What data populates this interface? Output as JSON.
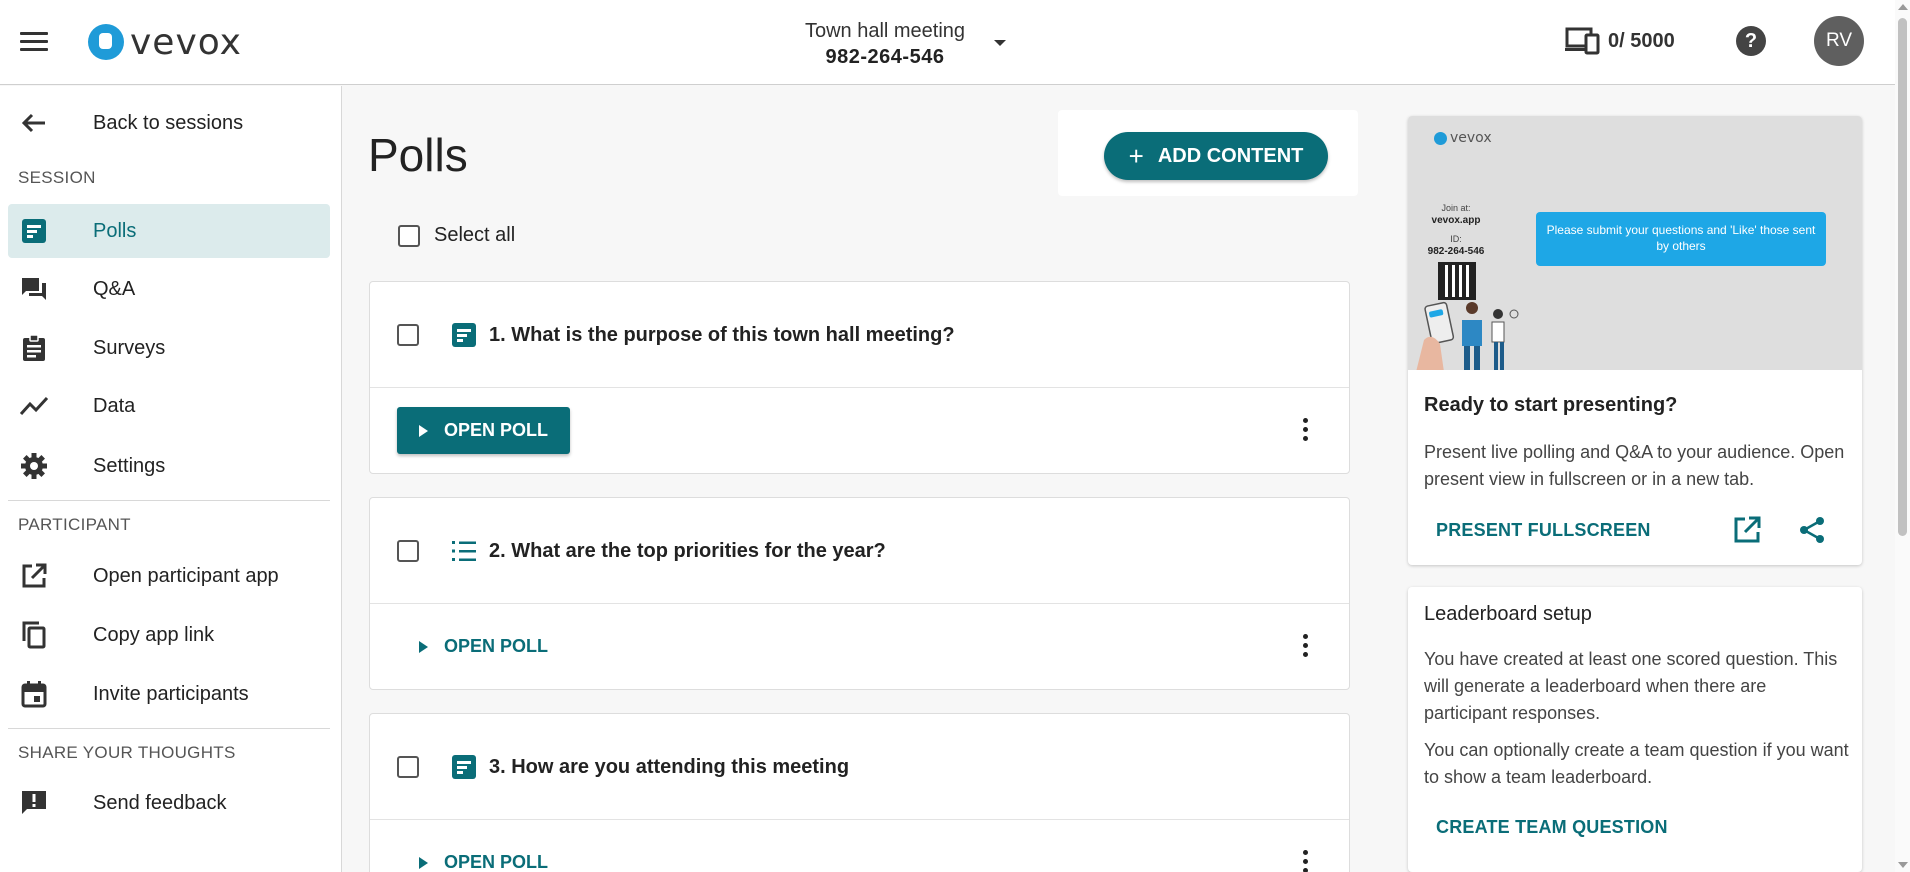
{
  "header": {
    "logo_text": "vevox",
    "session_name": "Town hall meeting",
    "session_id": "982-264-546",
    "participant_count": "0/ 5000",
    "help_label": "?",
    "avatar_initials": "RV"
  },
  "sidebar": {
    "back_label": "Back to sessions",
    "session_section": "SESSION",
    "session_items": [
      {
        "label": "Polls",
        "icon": "poll-icon",
        "active": true
      },
      {
        "label": "Q&A",
        "icon": "chat-icon"
      },
      {
        "label": "Surveys",
        "icon": "clipboard-icon"
      },
      {
        "label": "Data",
        "icon": "trend-icon"
      },
      {
        "label": "Settings",
        "icon": "gear-icon"
      }
    ],
    "participant_section": "PARTICIPANT",
    "participant_items": [
      {
        "label": "Open participant app",
        "icon": "open-external-icon"
      },
      {
        "label": "Copy app link",
        "icon": "copy-icon"
      },
      {
        "label": "Invite participants",
        "icon": "calendar-icon"
      }
    ],
    "feedback_section": "SHARE YOUR THOUGHTS",
    "feedback_items": [
      {
        "label": "Send feedback",
        "icon": "feedback-icon"
      }
    ]
  },
  "main": {
    "title": "Polls",
    "add_content_label": "ADD CONTENT",
    "select_all_label": "Select all",
    "polls": [
      {
        "question": "1. What is the purpose of this town hall meeting?",
        "type_icon": "poll-icon",
        "action": "OPEN POLL"
      },
      {
        "question": "2. What are the top priorities for the year?",
        "type_icon": "list-icon",
        "action": "OPEN POLL"
      },
      {
        "question": "3. How are you attending this meeting",
        "type_icon": "poll-icon",
        "action": "OPEN POLL"
      }
    ]
  },
  "present_card": {
    "preview_logo": "vevox",
    "preview_join_at": "Join at:",
    "preview_domain": "vevox.app",
    "preview_id_label": "ID:",
    "preview_id": "982-264-546",
    "preview_message": "Please submit your questions and 'Like' those sent by others",
    "title": "Ready to start presenting?",
    "text": "Present live polling and Q&A to your audience. Open present view in fullscreen or in a new tab.",
    "fullscreen_label": "PRESENT FULLSCREEN"
  },
  "leaderboard_card": {
    "title": "Leaderboard setup",
    "text1": "You have created at least one scored question. This will generate a leaderboard when there are participant responses.",
    "text2": "You can optionally create a team question if you want to show a team leaderboard.",
    "action_label": "CREATE TEAM QUESTION"
  },
  "colors": {
    "primary": "#0a6d78",
    "active_bg": "#dcebec",
    "brand_blue": "#1f9bd8"
  }
}
